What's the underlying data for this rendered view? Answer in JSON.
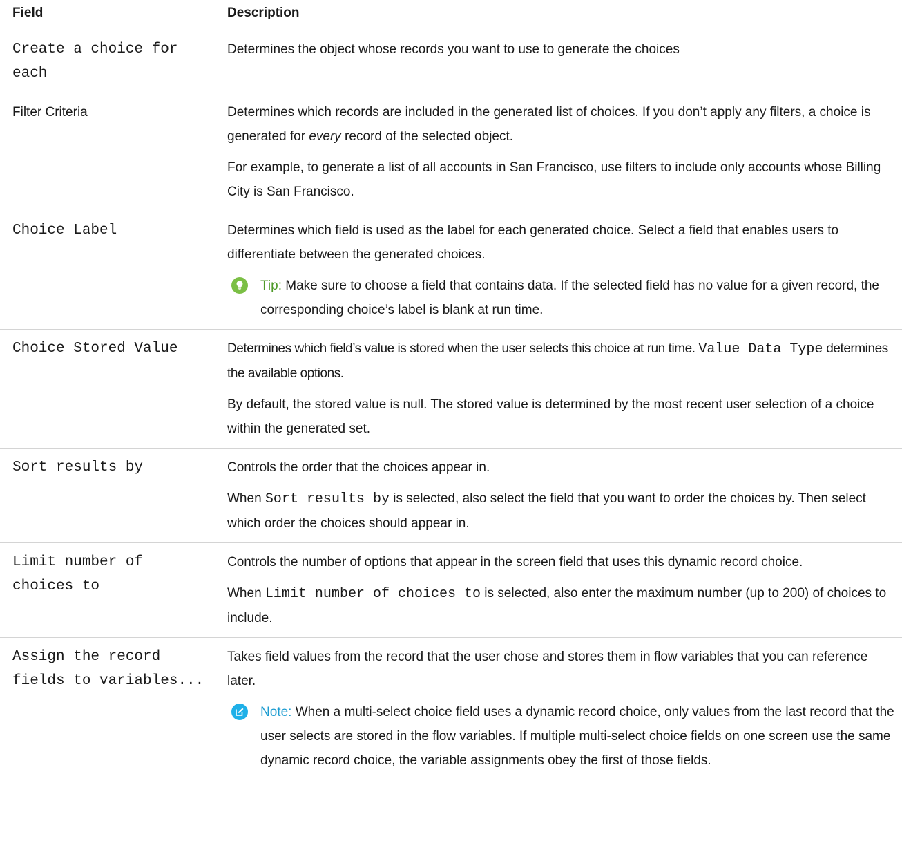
{
  "headers": {
    "field": "Field",
    "description": "Description"
  },
  "colors": {
    "tip": "#7bbf45",
    "tip_text": "#4e9a28",
    "note": "#1fb0e8",
    "note_text": "#1a9bd0",
    "border": "#d4d4d4"
  },
  "rows": [
    {
      "field": "Create a choice for each",
      "desc": [
        "Determines the object whose records you want to use to generate the choices"
      ]
    },
    {
      "field": "Filter Criteria",
      "desc_a_before": "Determines which records are included in the generated list of choices. If you don’t apply any filters, a choice is generated for ",
      "desc_a_em": "every",
      "desc_a_after": " record of the selected object.",
      "desc_b": "For example, to generate a list of all accounts in San Francisco, use filters to include only accounts whose Billing City is San Francisco."
    },
    {
      "field": "Choice Label",
      "desc": "Determines which field is used as the label for each generated choice. Select a field that enables users to differentiate between the generated choices.",
      "tip_label": "Tip:",
      "tip_text": " Make sure to choose a field that contains data. If the selected field has no value for a given record, the corresponding choice’s label is blank at run time.",
      "tip_icon": "lightbulb-icon"
    },
    {
      "field": "Choice Stored Value",
      "desc_a_before": "Determines which field’s value is stored when the user selects this choice at run time. ",
      "desc_a_code": "Value Data Type",
      "desc_a_after": " determines the available options.",
      "desc_b": "By default, the stored value is null. The stored value is determined by the most recent user selection of a choice within the generated set."
    },
    {
      "field": "Sort results by",
      "desc_a": "Controls the order that the choices appear in.",
      "desc_b_before": "When ",
      "desc_b_code": "Sort results by",
      "desc_b_after": " is selected, also select the field that you want to order the choices by. Then select which order the choices should appear in."
    },
    {
      "field": "Limit number of choices to",
      "desc_a": "Controls the number of options that appear in the screen field that uses this dynamic record choice.",
      "desc_b_before": "When ",
      "desc_b_code": "Limit number of choices to",
      "desc_b_after": " is selected, also enter the maximum number (up to 200) of choices to include."
    },
    {
      "field": "Assign the record fields to variables...",
      "desc_a": "Takes field values from the record that the user chose and stores them in flow variables that you can reference later.",
      "note_label": "Note:",
      "note_text": " When a multi-select choice field uses a dynamic record choice, only values from the last record that the user selects are stored in the flow variables. If multiple multi-select choice fields on one screen use the same dynamic record choice, the variable assignments obey the first of those fields.",
      "note_icon": "edit-note-icon"
    }
  ]
}
